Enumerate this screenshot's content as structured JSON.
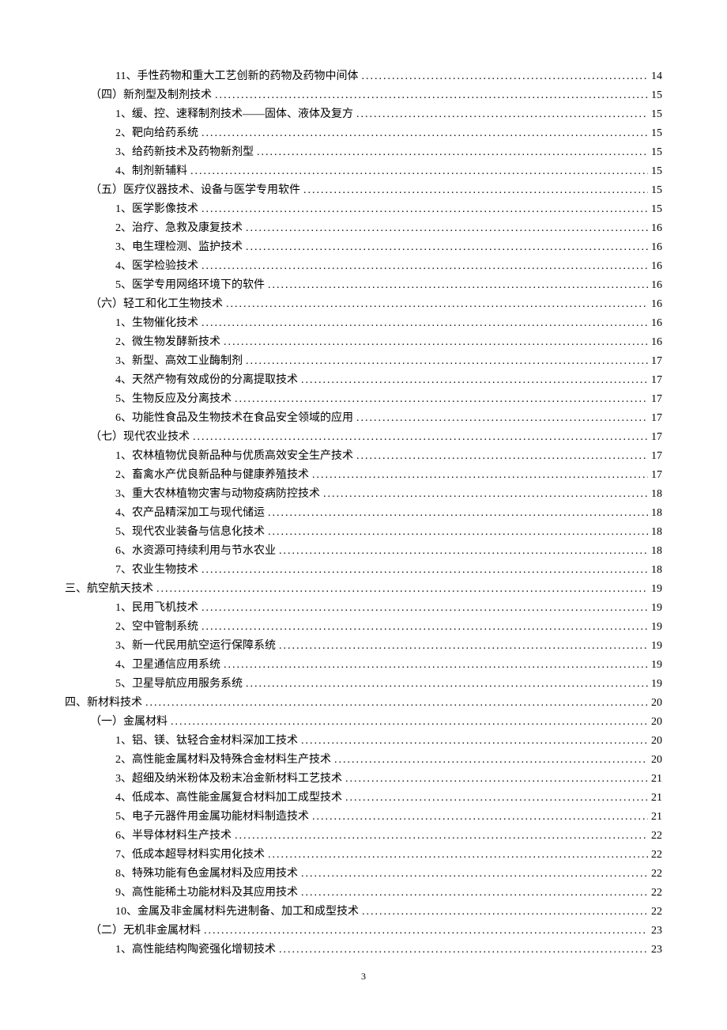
{
  "page_number": "3",
  "toc": [
    {
      "level": 3,
      "title": "11、手性药物和重大工艺创新的药物及药物中间体",
      "page": "14"
    },
    {
      "level": 2,
      "title": "（四）新剂型及制剂技术",
      "page": "15"
    },
    {
      "level": 3,
      "title": "1、缓、控、速释制剂技术——固体、液体及复方",
      "page": "15"
    },
    {
      "level": 3,
      "title": "2、靶向给药系统",
      "page": "15"
    },
    {
      "level": 3,
      "title": "3、给药新技术及药物新剂型",
      "page": "15"
    },
    {
      "level": 3,
      "title": "4、制剂新辅料",
      "page": "15"
    },
    {
      "level": 2,
      "title": "（五）医疗仪器技术、设备与医学专用软件",
      "page": "15"
    },
    {
      "level": 3,
      "title": "1、医学影像技术",
      "page": "15"
    },
    {
      "level": 3,
      "title": "2、治疗、急救及康复技术",
      "page": "16"
    },
    {
      "level": 3,
      "title": "3、电生理检测、监护技术",
      "page": "16"
    },
    {
      "level": 3,
      "title": "4、医学检验技术",
      "page": "16"
    },
    {
      "level": 3,
      "title": "5、医学专用网络环境下的软件",
      "page": "16"
    },
    {
      "level": 2,
      "title": "（六）轻工和化工生物技术",
      "page": "16"
    },
    {
      "level": 3,
      "title": "1、生物催化技术",
      "page": "16"
    },
    {
      "level": 3,
      "title": "2、微生物发酵新技术",
      "page": "16"
    },
    {
      "level": 3,
      "title": "3、新型、高效工业酶制剂",
      "page": "17"
    },
    {
      "level": 3,
      "title": "4、天然产物有效成份的分离提取技术",
      "page": "17"
    },
    {
      "level": 3,
      "title": "5、生物反应及分离技术",
      "page": "17"
    },
    {
      "level": 3,
      "title": "6、功能性食品及生物技术在食品安全领域的应用",
      "page": "17"
    },
    {
      "level": 2,
      "title": "（七）现代农业技术",
      "page": "17"
    },
    {
      "level": 3,
      "title": "1、农林植物优良新品种与优质高效安全生产技术",
      "page": "17"
    },
    {
      "level": 3,
      "title": "2、畜禽水产优良新品种与健康养殖技术",
      "page": "17"
    },
    {
      "level": 3,
      "title": "3、重大农林植物灾害与动物疫病防控技术",
      "page": "18"
    },
    {
      "level": 3,
      "title": "4、农产品精深加工与现代储运",
      "page": "18"
    },
    {
      "level": 3,
      "title": "5、现代农业装备与信息化技术",
      "page": "18"
    },
    {
      "level": 3,
      "title": "6、水资源可持续利用与节水农业",
      "page": "18"
    },
    {
      "level": 3,
      "title": "7、农业生物技术",
      "page": "18"
    },
    {
      "level": 1,
      "title": "三、航空航天技术",
      "page": "19"
    },
    {
      "level": 3,
      "title": "1、民用飞机技术",
      "page": "19"
    },
    {
      "level": 3,
      "title": "2、空中管制系统",
      "page": "19"
    },
    {
      "level": 3,
      "title": "3、新一代民用航空运行保障系统",
      "page": "19"
    },
    {
      "level": 3,
      "title": "4、卫星通信应用系统",
      "page": "19"
    },
    {
      "level": 3,
      "title": "5、卫星导航应用服务系统",
      "page": "19"
    },
    {
      "level": 1,
      "title": "四、新材料技术",
      "page": "20"
    },
    {
      "level": 2,
      "title": "（一）金属材料",
      "page": "20"
    },
    {
      "level": 3,
      "title": "1、铝、镁、钛轻合金材料深加工技术",
      "page": "20"
    },
    {
      "level": 3,
      "title": "2、高性能金属材料及特殊合金材料生产技术",
      "page": "20"
    },
    {
      "level": 3,
      "title": "3、超细及纳米粉体及粉末冶金新材料工艺技术",
      "page": "21"
    },
    {
      "level": 3,
      "title": "4、低成本、高性能金属复合材料加工成型技术",
      "page": "21"
    },
    {
      "level": 3,
      "title": "5、电子元器件用金属功能材料制造技术",
      "page": "21"
    },
    {
      "level": 3,
      "title": "6、半导体材料生产技术",
      "page": "22"
    },
    {
      "level": 3,
      "title": "7、低成本超导材料实用化技术",
      "page": "22"
    },
    {
      "level": 3,
      "title": "8、特殊功能有色金属材料及应用技术",
      "page": "22"
    },
    {
      "level": 3,
      "title": "9、高性能稀土功能材料及其应用技术",
      "page": "22"
    },
    {
      "level": 3,
      "title": "10、金属及非金属材料先进制备、加工和成型技术",
      "page": "22"
    },
    {
      "level": 2,
      "title": "（二）无机非金属材料",
      "page": "23"
    },
    {
      "level": 3,
      "title": "1、高性能结构陶瓷强化增韧技术",
      "page": "23"
    }
  ]
}
